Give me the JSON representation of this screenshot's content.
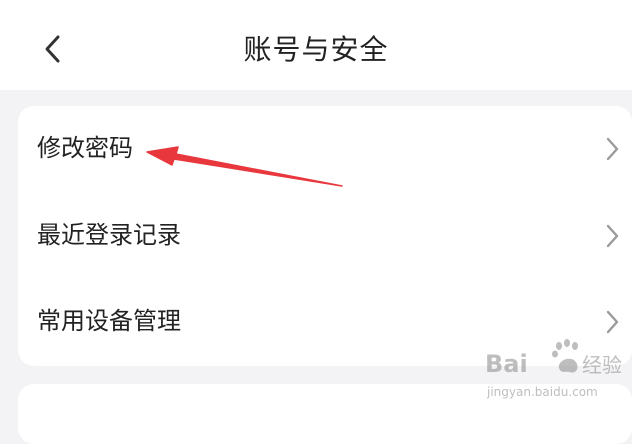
{
  "header": {
    "title": "账号与安全",
    "back_icon": "chevron-left-icon"
  },
  "menu": {
    "items": [
      {
        "label": "修改密码",
        "icon": "chevron-right-icon"
      },
      {
        "label": "最近登录记录",
        "icon": "chevron-right-icon"
      },
      {
        "label": "常用设备管理",
        "icon": "chevron-right-icon"
      }
    ]
  },
  "annotation": {
    "arrow_color": "#e8383d",
    "target": "修改密码"
  },
  "watermark": {
    "brand": "Bai",
    "brand_cn": "经验",
    "domain": "jingyan.baidu.com"
  },
  "colors": {
    "background": "#f3f3f5",
    "card": "#ffffff",
    "text": "#222222",
    "chevron": "#9a9a9a"
  }
}
